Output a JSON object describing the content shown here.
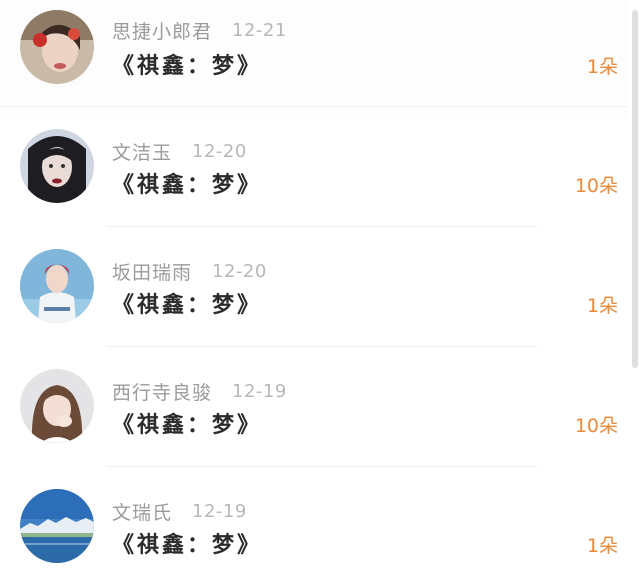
{
  "items": [
    {
      "name": "思捷小郎君",
      "date": "12-21",
      "gift": "《祺鑫：梦》",
      "amount": "1朵"
    },
    {
      "name": "文洁玉",
      "date": "12-20",
      "gift": "《祺鑫：梦》",
      "amount": "10朵"
    },
    {
      "name": "坂田瑞雨",
      "date": "12-20",
      "gift": "《祺鑫：梦》",
      "amount": "1朵"
    },
    {
      "name": "西行寺良骏",
      "date": "12-19",
      "gift": "《祺鑫：梦》",
      "amount": "10朵"
    },
    {
      "name": "文瑞氏",
      "date": "12-19",
      "gift": "《祺鑫：梦》",
      "amount": "1朵"
    }
  ],
  "colors": {
    "amount": "#e98a3c",
    "name": "#9b9b9b",
    "date": "#b7b7b7",
    "gift": "#2b2b2b"
  },
  "icons": [
    "avatar-photo"
  ]
}
